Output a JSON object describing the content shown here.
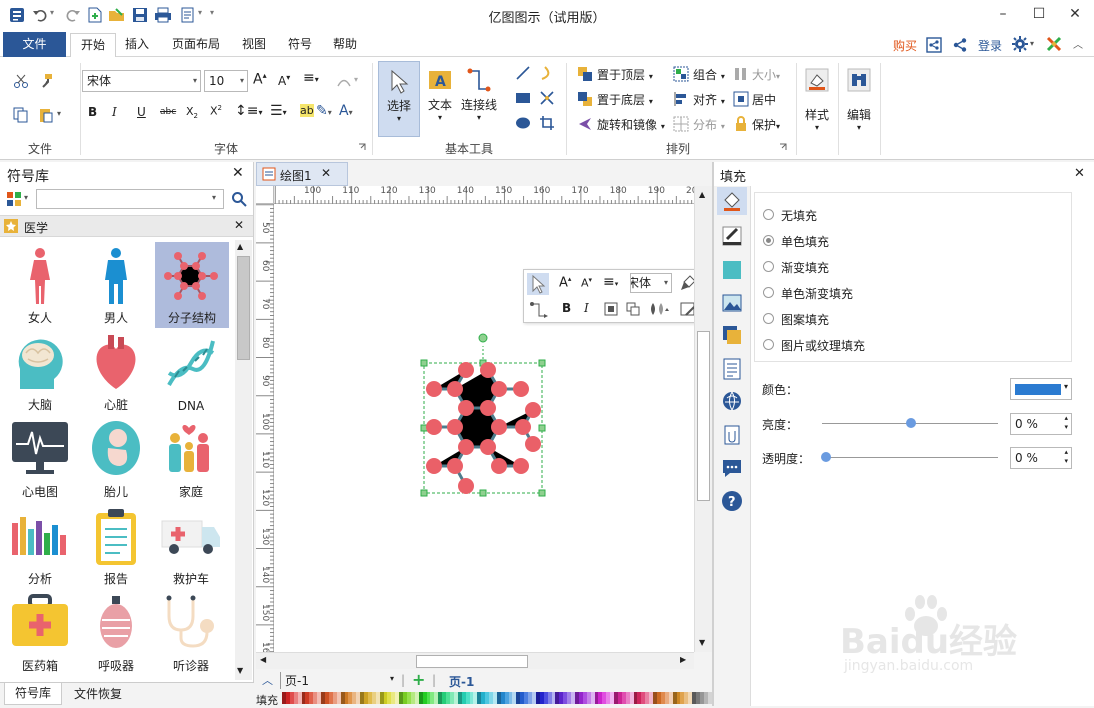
{
  "window": {
    "title": "亿图图示（试用版）"
  },
  "menu": {
    "file": "文件",
    "tabs": [
      "开始",
      "插入",
      "页面布局",
      "视图",
      "符号",
      "帮助"
    ],
    "right": {
      "buy": "购买",
      "login": "登录"
    }
  },
  "ribbon": {
    "groups": {
      "file": "文件",
      "font": "字体",
      "basic_tools": "基本工具",
      "arrange": "排列"
    },
    "font_name": "宋体",
    "font_size": "10",
    "tools": {
      "select": "选择",
      "text": "文本",
      "connector": "连接线"
    },
    "arrange": {
      "bring_front": "置于顶层",
      "send_back": "置于底层",
      "rotate_mirror": "旋转和镜像",
      "group": "组合",
      "align": "对齐",
      "distribute": "分布",
      "size": "大小",
      "center": "居中",
      "protect": "保护"
    },
    "style": "样式",
    "edit": "编辑"
  },
  "library": {
    "title": "符号库",
    "search_value": "",
    "category": "医学",
    "items": [
      {
        "label": "女人",
        "icon": "woman-icon"
      },
      {
        "label": "男人",
        "icon": "man-icon"
      },
      {
        "label": "分子结构",
        "icon": "molecule-icon"
      },
      {
        "label": "大脑",
        "icon": "brain-icon"
      },
      {
        "label": "心脏",
        "icon": "heart-icon"
      },
      {
        "label": "DNA",
        "icon": "dna-icon"
      },
      {
        "label": "心电图",
        "icon": "ecg-monitor-icon"
      },
      {
        "label": "胎儿",
        "icon": "fetus-icon"
      },
      {
        "label": "家庭",
        "icon": "family-icon"
      },
      {
        "label": "分析",
        "icon": "analysis-chart-icon"
      },
      {
        "label": "报告",
        "icon": "report-clipboard-icon"
      },
      {
        "label": "救护车",
        "icon": "ambulance-icon"
      },
      {
        "label": "医药箱",
        "icon": "medical-kit-icon"
      },
      {
        "label": "呼吸器",
        "icon": "respirator-icon"
      },
      {
        "label": "听诊器",
        "icon": "stethoscope-icon"
      }
    ],
    "bottom_tabs": [
      "符号库",
      "文件恢复"
    ]
  },
  "document": {
    "tab": "绘图1",
    "ruler_top": [
      "100",
      "110",
      "120",
      "130",
      "140",
      "150",
      "160",
      "170",
      "180",
      "190",
      "200"
    ],
    "ruler_left": [
      "50",
      "60",
      "70",
      "80",
      "90",
      "100",
      "110",
      "120",
      "130",
      "140",
      "150",
      "160"
    ],
    "mini_toolbar": {
      "font": "宋体"
    },
    "page_select": "页-1",
    "page_tab": "页-1",
    "fill_label": "填充"
  },
  "fill_panel": {
    "title": "填充",
    "options": [
      "无填充",
      "单色填充",
      "渐变填充",
      "单色渐变填充",
      "图案填充",
      "图片或纹理填充"
    ],
    "selected": "单色填充",
    "color_label": "颜色：",
    "color": "#2b7bd1",
    "brightness_label": "亮度：",
    "brightness_value": "0 %",
    "transparency_label": "透明度：",
    "transparency_value": "0 %"
  },
  "colors": {
    "accent": "#2b5797",
    "molecule_node": "#ea6068",
    "molecule_bond": "#4f7c8c",
    "selection": "#2fae4a",
    "buy": "#e0561a"
  },
  "watermark": {
    "text": "Baidu经验",
    "sub": "jingyan.baidu.com"
  }
}
